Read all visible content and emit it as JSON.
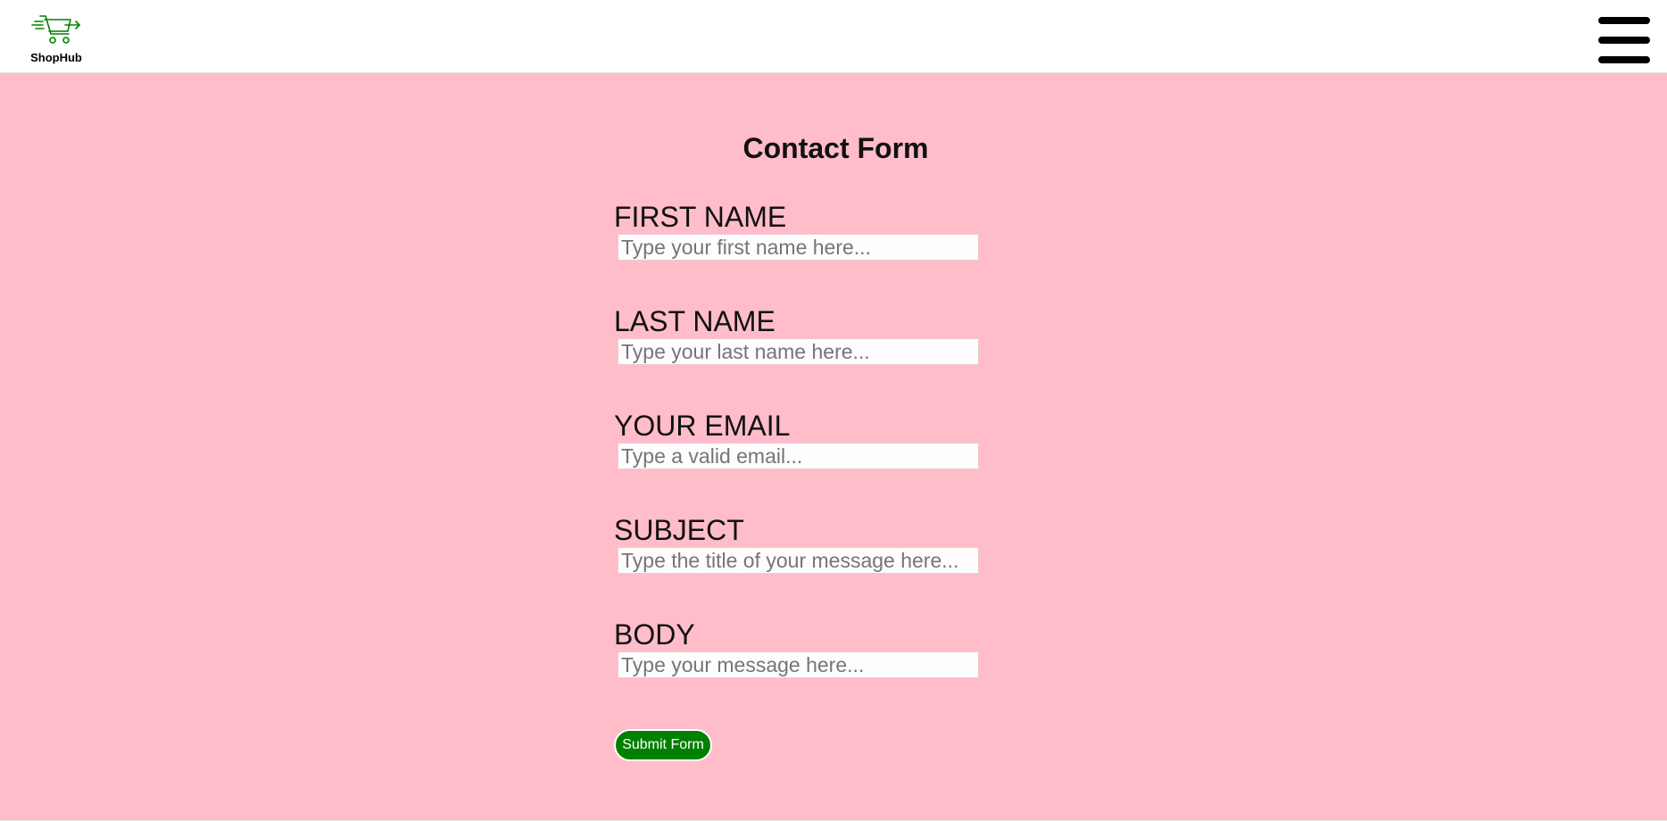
{
  "header": {
    "logo_text": "ShopHub",
    "logo_icon": "shopping-cart-icon",
    "menu_icon": "hamburger-menu-icon",
    "brand_color": "#008000"
  },
  "form": {
    "title": "Contact Form",
    "fields": [
      {
        "label": "FIRST NAME",
        "placeholder": "Type your first name here...",
        "value": ""
      },
      {
        "label": "LAST NAME",
        "placeholder": "Type your last name here...",
        "value": ""
      },
      {
        "label": "YOUR EMAIL",
        "placeholder": "Type a valid email...",
        "value": ""
      },
      {
        "label": "SUBJECT",
        "placeholder": "Type the title of your message here...",
        "value": ""
      },
      {
        "label": "BODY",
        "placeholder": "Type your message here...",
        "value": ""
      }
    ],
    "submit_label": "Submit Form"
  },
  "colors": {
    "page_background": "#ffbdc9",
    "header_background": "#ffffff",
    "submit_background": "#008000"
  }
}
